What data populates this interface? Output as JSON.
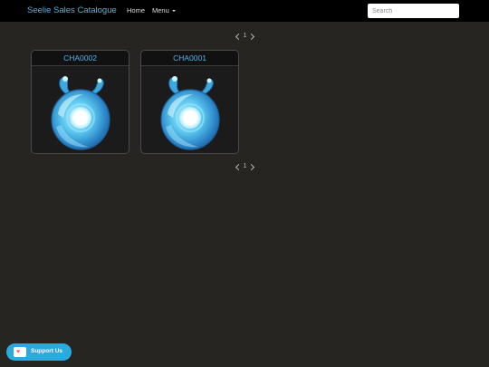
{
  "header": {
    "brand": "Seelie Sales Catalogue",
    "nav": {
      "home": "Home",
      "menu": "Menu"
    },
    "search": {
      "placeholder": "Search",
      "value": ""
    }
  },
  "pagination": {
    "current_page": "1"
  },
  "cards": [
    {
      "id": "CHA0002",
      "image_icon": "seelie-icon"
    },
    {
      "id": "CHA0001",
      "image_icon": "seelie-icon"
    }
  ],
  "support": {
    "label": "Support Us",
    "icon": "heart-mug-icon"
  },
  "colors": {
    "accent": "#4fb3e6",
    "background": "#262522",
    "topbar": "#000000",
    "support_button": "#29abe0"
  }
}
